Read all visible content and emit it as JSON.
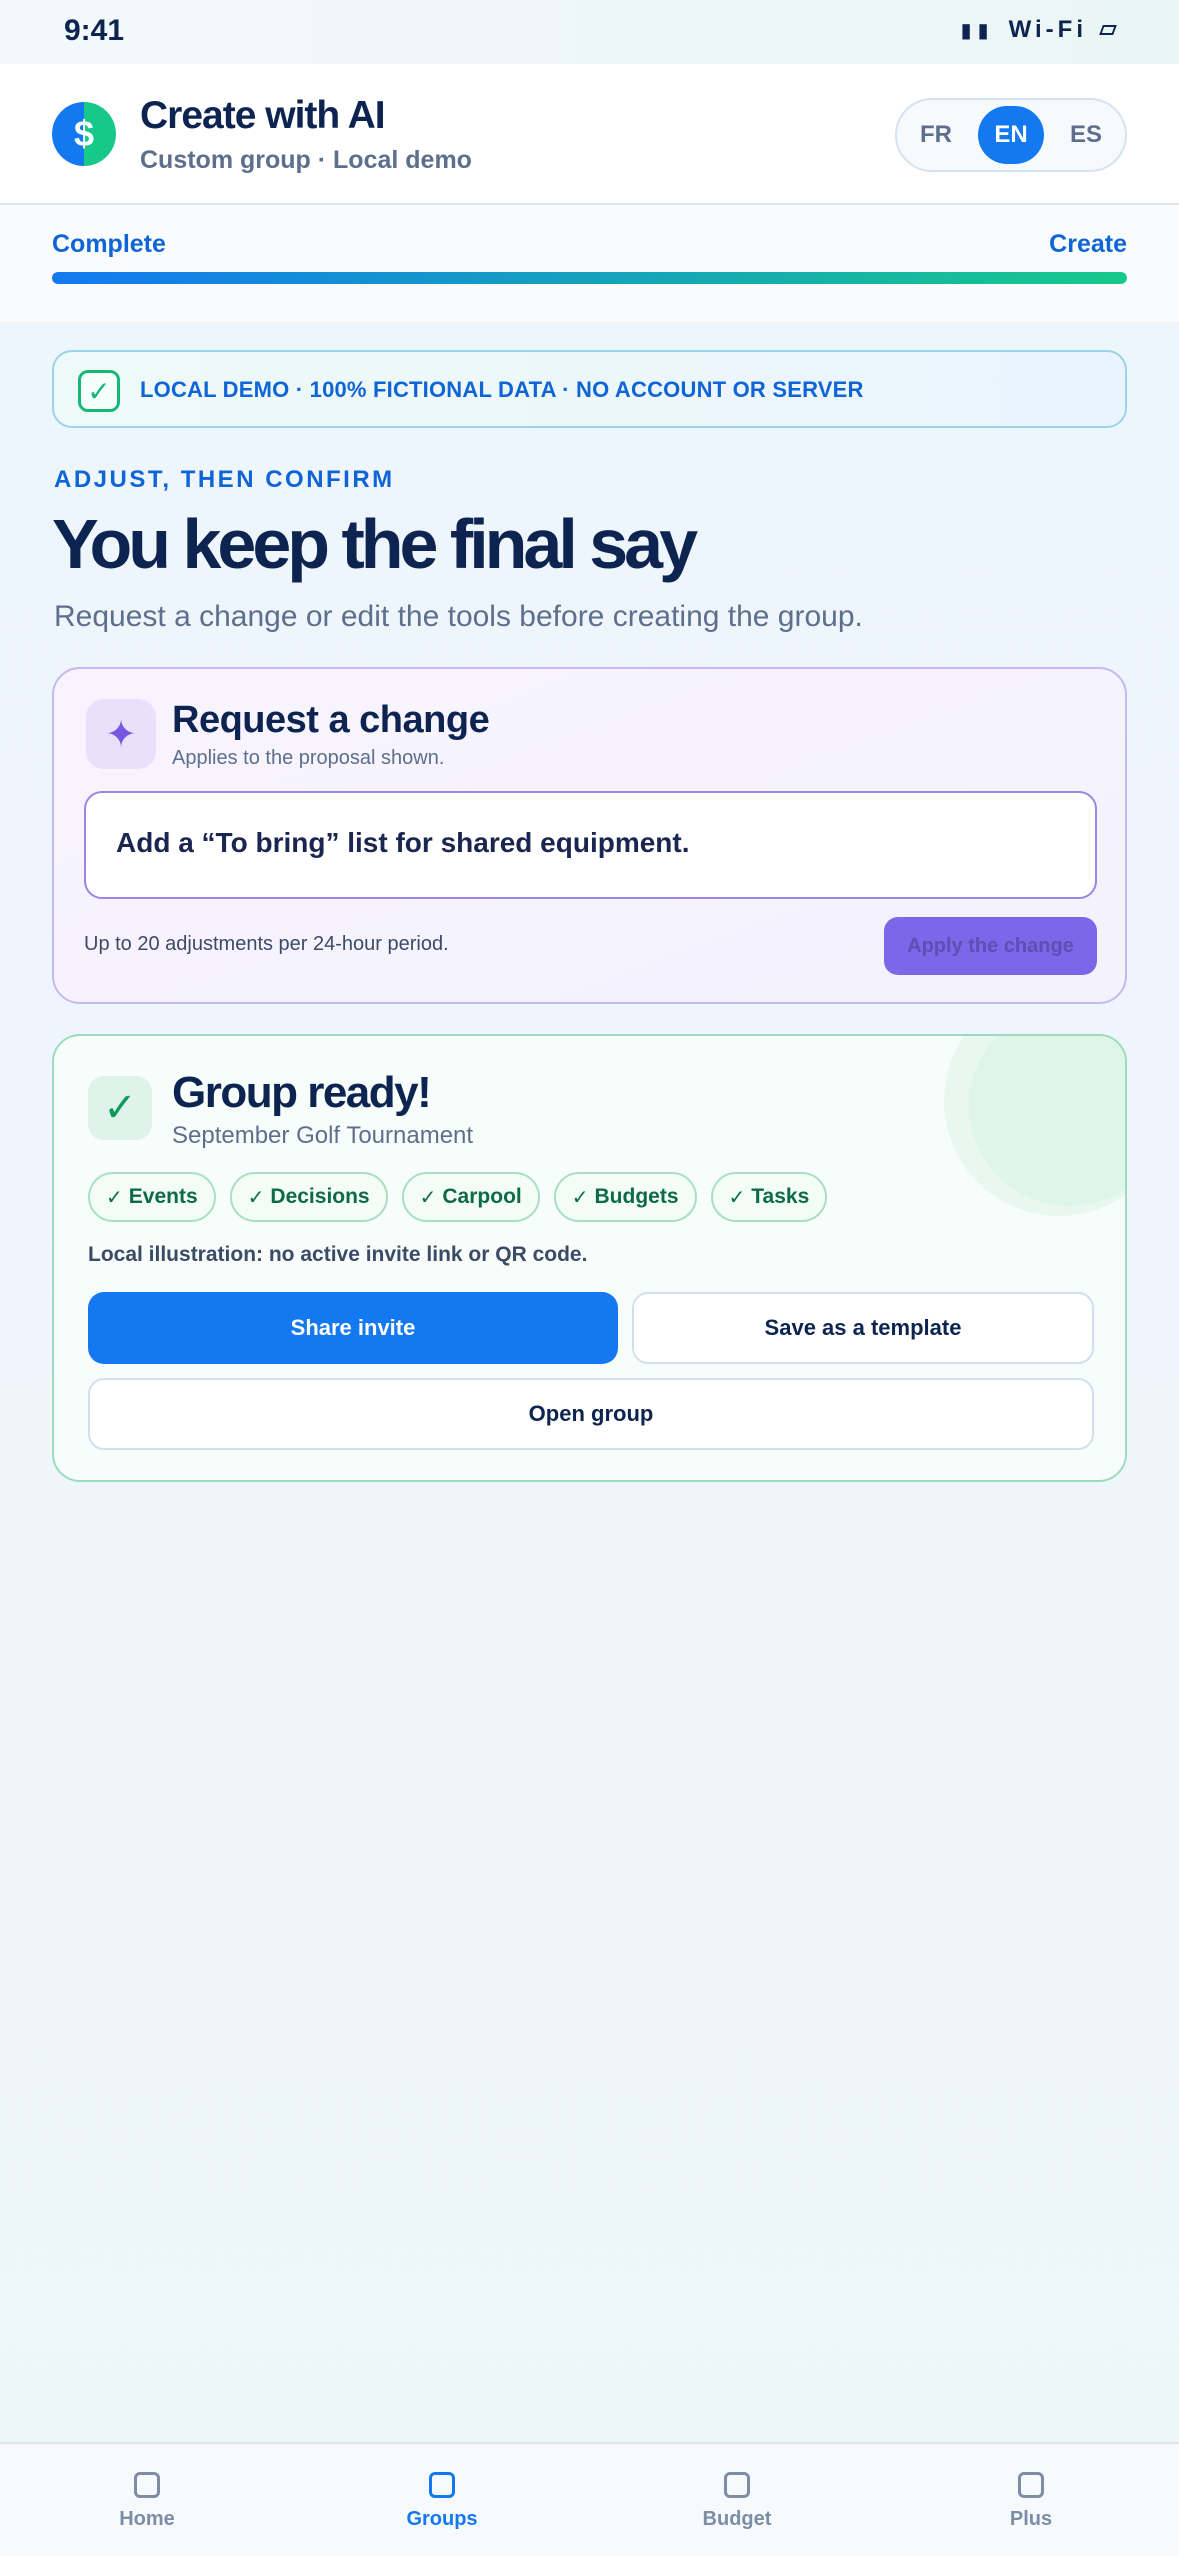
{
  "status_bar": {
    "time": "9:41",
    "signal": "▮▮",
    "wifi": "Wi-Fi"
  },
  "header": {
    "logo_glyph": "$",
    "title": "Create with AI",
    "subtitle": "Custom group · Local demo",
    "languages": [
      "FR",
      "EN",
      "ES"
    ],
    "selected_language": "EN"
  },
  "progress": {
    "left_label": "Complete",
    "right_label": "Create",
    "value_percent": 100
  },
  "banner": {
    "icon": "check-icon",
    "text": "LOCAL DEMO · 100% FICTIONAL DATA · NO ACCOUNT OR SERVER"
  },
  "intro": {
    "eyebrow": "ADJUST, THEN CONFIRM",
    "headline": "You keep the final say",
    "lead": "Request a change or edit the tools before creating the group."
  },
  "request_card": {
    "icon": "sparkle-icon",
    "title": "Request a change",
    "subtitle": "Applies to the proposal shown.",
    "input_value": "Add a “To bring” list for shared equipment.",
    "limit_text": "Up to 20 adjustments per 24-hour period.",
    "apply_label": "Apply the change"
  },
  "ready_card": {
    "icon": "check-icon",
    "title": "Group ready!",
    "group_name": "September Golf Tournament",
    "features": [
      "Events",
      "Decisions",
      "Carpool",
      "Budgets",
      "Tasks"
    ],
    "note": "Local illustration: no active invite link or QR code.",
    "share_label": "Share invite",
    "template_label": "Save as a template",
    "open_label": "Open group"
  },
  "tabbar": {
    "items": [
      "Home",
      "Groups",
      "Budget",
      "Plus"
    ],
    "active": "Groups"
  },
  "colors": {
    "primary": "#1479f0",
    "success": "#16c98a",
    "accent_purple": "#7b67e8",
    "text_dark": "#0d2350",
    "text_muted": "#5d6f8c"
  }
}
